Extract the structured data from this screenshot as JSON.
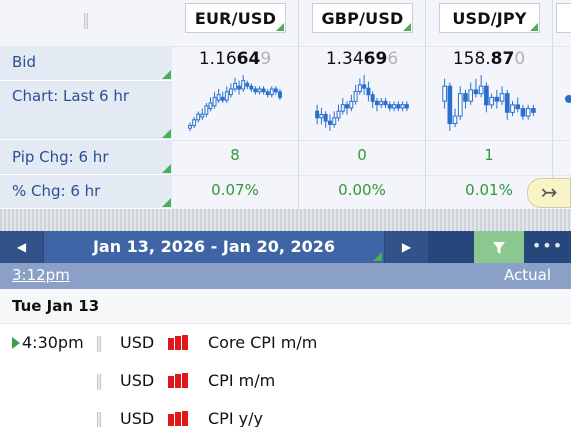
{
  "rates": {
    "labels": {
      "bid": "Bid",
      "chart": "Chart: Last 6 hr",
      "pip_chg": "Pip Chg: 6 hr",
      "pct_chg": "% Chg: 6 hr"
    },
    "pairs": [
      {
        "name": "EUR/USD",
        "bid_pre": "1.16",
        "bid_big": "64",
        "bid_pip": "9",
        "pip_chg": "8",
        "pct_chg": "0.07%",
        "candles": [
          [
            2,
            3,
            1,
            4
          ],
          [
            3,
            5,
            2,
            6
          ],
          [
            5,
            7,
            4,
            8
          ],
          [
            6,
            7,
            5,
            9
          ],
          [
            7,
            10,
            6,
            11
          ],
          [
            9,
            11,
            8,
            13
          ],
          [
            10,
            13,
            9,
            15
          ],
          [
            12,
            14,
            11,
            16
          ],
          [
            13,
            12,
            11,
            15
          ],
          [
            12,
            15,
            11,
            17
          ],
          [
            14,
            16,
            13,
            18
          ],
          [
            16,
            18,
            15,
            20
          ],
          [
            17,
            16,
            14,
            19
          ],
          [
            16,
            19,
            15,
            21
          ],
          [
            18,
            17,
            16,
            19
          ],
          [
            17,
            16,
            15,
            18
          ],
          [
            16,
            15,
            14,
            17
          ],
          [
            15,
            16,
            14,
            17
          ],
          [
            16,
            15,
            14,
            17
          ],
          [
            15,
            14,
            13,
            16
          ],
          [
            14,
            16,
            13,
            17
          ],
          [
            16,
            15,
            14,
            17
          ],
          [
            15,
            13,
            12,
            16
          ]
        ]
      },
      {
        "name": "GBP/USD",
        "bid_pre": "1.34",
        "bid_big": "69",
        "bid_pip": "6",
        "pip_chg": "0",
        "pct_chg": "0.00%",
        "candles": [
          [
            10,
            8,
            6,
            12
          ],
          [
            8,
            9,
            6,
            11
          ],
          [
            9,
            7,
            5,
            10
          ],
          [
            7,
            6,
            4,
            9
          ],
          [
            6,
            8,
            5,
            10
          ],
          [
            8,
            10,
            7,
            12
          ],
          [
            10,
            12,
            9,
            14
          ],
          [
            12,
            11,
            9,
            13
          ],
          [
            11,
            13,
            10,
            15
          ],
          [
            13,
            16,
            12,
            18
          ],
          [
            16,
            18,
            15,
            20
          ],
          [
            18,
            17,
            15,
            21
          ],
          [
            17,
            15,
            13,
            19
          ],
          [
            15,
            13,
            11,
            16
          ],
          [
            13,
            12,
            10,
            14
          ],
          [
            12,
            13,
            11,
            14
          ],
          [
            13,
            12,
            11,
            14
          ],
          [
            12,
            11,
            10,
            13
          ],
          [
            11,
            12,
            10,
            13
          ],
          [
            12,
            11,
            10,
            13
          ],
          [
            11,
            12,
            10,
            13
          ],
          [
            12,
            11,
            10,
            13
          ]
        ]
      },
      {
        "name": "USD/JPY",
        "bid_pre": "158.",
        "bid_big": "87",
        "bid_pip": "0",
        "pip_chg": "1",
        "pct_chg": "0.01%",
        "candles": [
          [
            14,
            18,
            12,
            20
          ],
          [
            18,
            8,
            6,
            19
          ],
          [
            8,
            10,
            7,
            12
          ],
          [
            10,
            16,
            9,
            18
          ],
          [
            16,
            14,
            12,
            17
          ],
          [
            14,
            17,
            13,
            19
          ],
          [
            17,
            16,
            15,
            20
          ],
          [
            16,
            18,
            15,
            21
          ],
          [
            18,
            13,
            11,
            19
          ],
          [
            13,
            15,
            12,
            16
          ],
          [
            15,
            14,
            12,
            17
          ],
          [
            14,
            16,
            13,
            18
          ],
          [
            16,
            11,
            9,
            17
          ],
          [
            11,
            13,
            10,
            14
          ],
          [
            13,
            12,
            11,
            15
          ],
          [
            12,
            10,
            9,
            13
          ],
          [
            10,
            12,
            9,
            13
          ],
          [
            12,
            11,
            10,
            13
          ]
        ]
      }
    ],
    "swap_icon": "swap-arrow-icon"
  },
  "calendar": {
    "date_range": "Jan 13, 2026 - Jan 20, 2026",
    "prev_icon": "chevron-left-icon",
    "next_icon": "chevron-right-icon",
    "filter_icon": "filter-icon",
    "more_icon": "more-icon",
    "time_header": "3:12pm",
    "actual_header": "Actual",
    "day": "Tue Jan 13",
    "events": [
      {
        "time": "4:30pm",
        "currency": "USD",
        "title": "Core CPI m/m",
        "current": true
      },
      {
        "time": "",
        "currency": "USD",
        "title": "CPI m/m",
        "current": false
      },
      {
        "time": "",
        "currency": "USD",
        "title": "CPI y/y",
        "current": false
      }
    ]
  },
  "colors": {
    "header_bg": "#3b5c97",
    "label_text": "#2a4f93",
    "positive": "#2f9a3a",
    "impact_high": "#e0181b",
    "candle": "#2a6fd0"
  }
}
